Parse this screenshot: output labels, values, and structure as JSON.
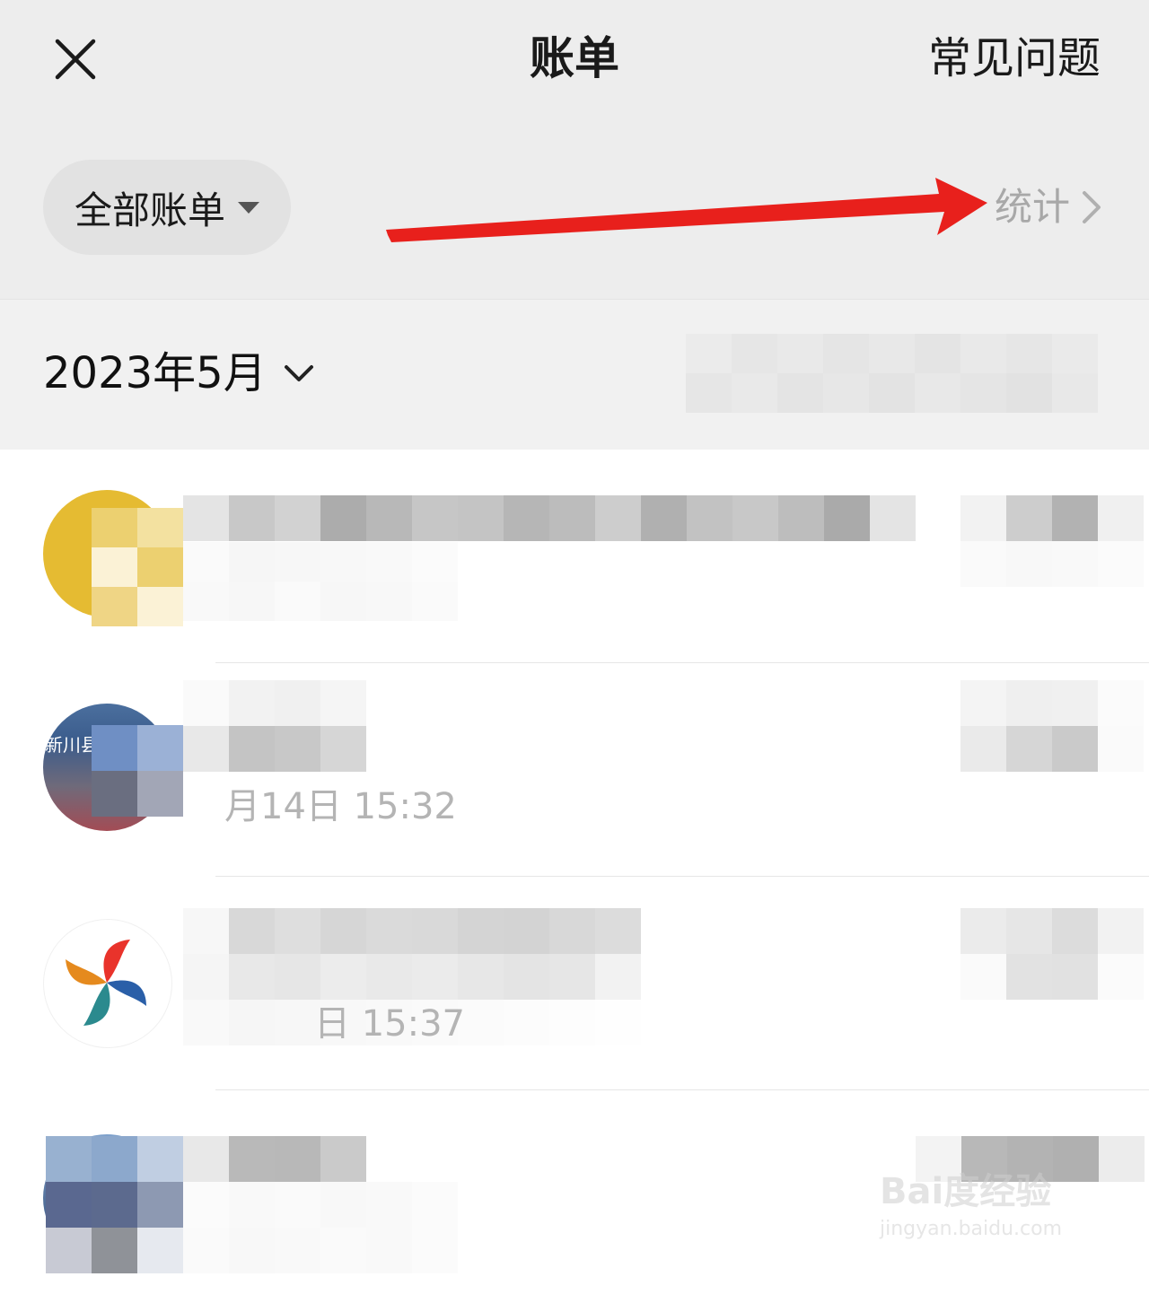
{
  "header": {
    "title": "账单",
    "faq_label": "常见问题",
    "close_icon": "close-icon"
  },
  "filter": {
    "label": "全部账单",
    "icon": "caret-down-icon"
  },
  "stats": {
    "label": "统计",
    "icon": "chevron-right-icon"
  },
  "month": {
    "label": "2023年5月",
    "icon": "chevron-down-icon"
  },
  "transactions": [
    {
      "avatar": "gold-circle-avatar",
      "time": ""
    },
    {
      "avatar": "street-photo-avatar",
      "avatar_caption": "新川县",
      "time": "月14日 15:32"
    },
    {
      "avatar": "pinwheel-logo-avatar",
      "time": "日 15:37"
    },
    {
      "avatar": "blue-photo-avatar",
      "time": ""
    }
  ],
  "watermark": {
    "logo": "Bai度经验",
    "url": "jingyan.baidu.com"
  },
  "colors": {
    "header_bg": "#ededed",
    "annotation_arrow": "#e8201c",
    "muted_text": "#a8a8a8"
  }
}
